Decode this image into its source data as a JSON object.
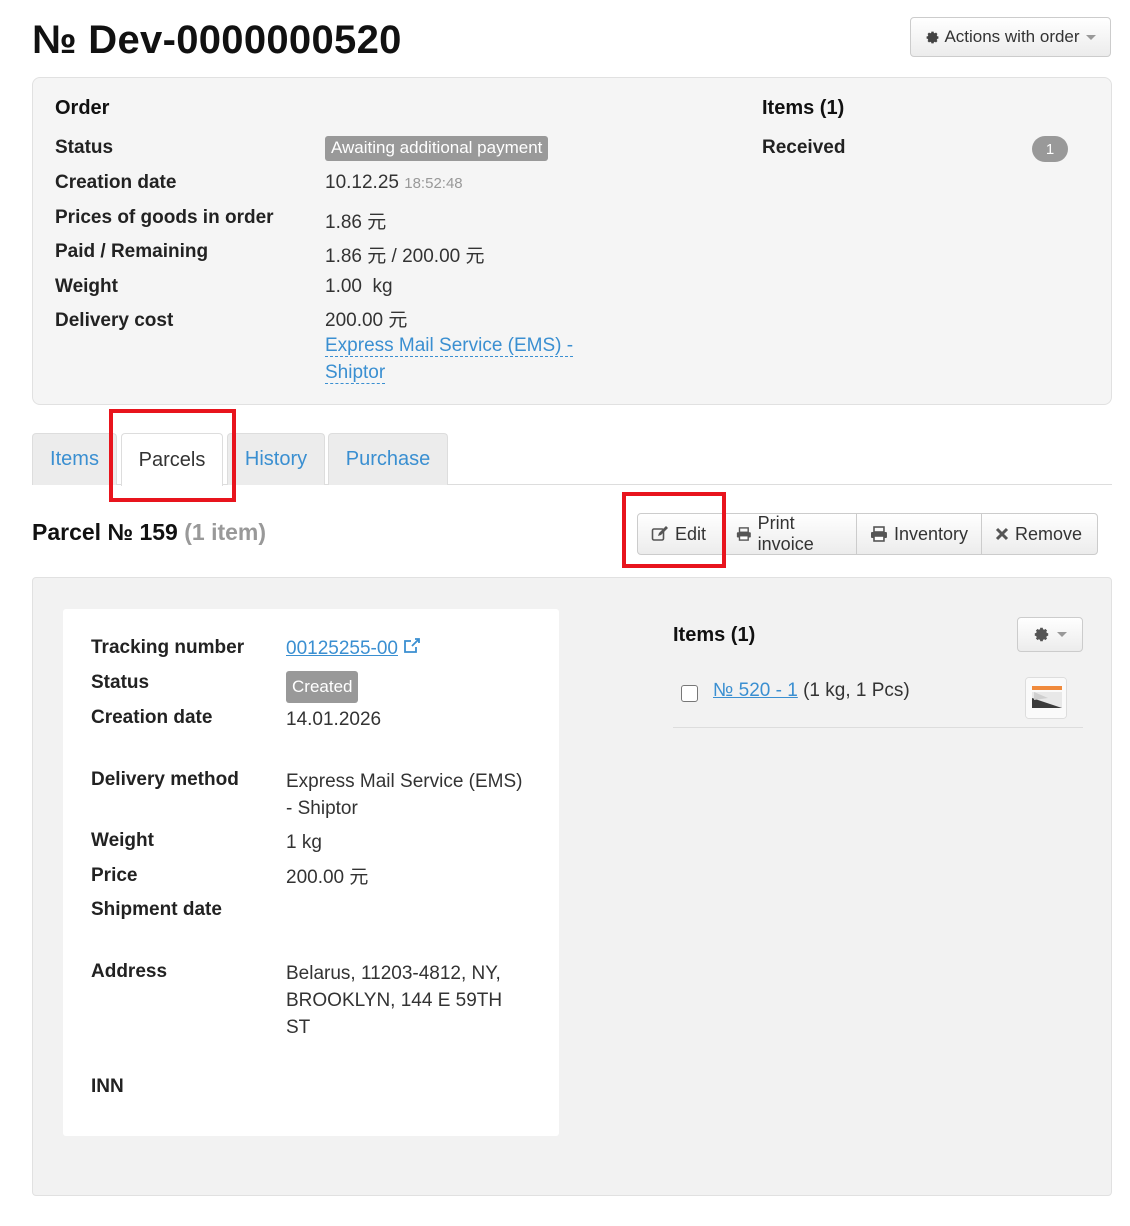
{
  "page": {
    "title": "№ Dev-0000000520"
  },
  "actions": {
    "label": "Actions with order"
  },
  "order": {
    "heading": "Order",
    "status_label": "Status",
    "status_value": "Awaiting additional payment",
    "creation_label": "Creation date",
    "creation_date": "10.12.25",
    "creation_time": "18:52:48",
    "prices_label": "Prices of goods in order",
    "prices_value": "1.86 元",
    "paid_label": "Paid / Remaining",
    "paid_value": "1.86 元 / 200.00 元",
    "weight_label": "Weight",
    "weight_value": "1.00  kg",
    "delivery_label": "Delivery cost",
    "delivery_value": "200.00 元",
    "delivery_method_line1": "Express Mail Service (EMS) -",
    "delivery_method_line2": "Shiptor"
  },
  "items_summary": {
    "heading": "Items (1)",
    "received_label": "Received",
    "received_count": "1"
  },
  "tabs": [
    {
      "label": "Items",
      "active": false
    },
    {
      "label": "Parcels",
      "active": true
    },
    {
      "label": "History",
      "active": false
    },
    {
      "label": "Purchase",
      "active": false
    }
  ],
  "parcel": {
    "title": "Parcel № 159",
    "count": "(1 item)",
    "buttons": {
      "edit": "Edit",
      "print": "Print invoice",
      "inventory": "Inventory",
      "remove": "Remove"
    },
    "info": {
      "tracking_label": "Tracking number",
      "tracking_value": "00125255-00",
      "status_label": "Status",
      "status_value": "Created",
      "creation_label": "Creation date",
      "creation_value": "14.01.2026",
      "method_label": "Delivery method",
      "method_line1": "Express Mail Service (EMS)",
      "method_line2": "- Shiptor",
      "weight_label": "Weight",
      "weight_value": "1 kg",
      "price_label": "Price",
      "price_value": "200.00 元",
      "shipment_label": "Shipment date",
      "address_label": "Address",
      "address_line1": "Belarus, 11203-4812, NY,",
      "address_line2": "BROOKLYN, 144 E 59TH",
      "address_line3": "ST",
      "inn_label": "INN"
    },
    "items_heading": "Items (1)",
    "item": {
      "link": "№ 520 - 1",
      "details": "(1 kg, 1 Pcs)"
    }
  },
  "colors": {
    "link": "#3a8fd1",
    "highlight": "#e8141d",
    "badge": "#999999"
  },
  "icons": [
    "gear-icon",
    "caret-down-icon",
    "edit-icon",
    "printer-icon",
    "close-icon",
    "external-link-icon"
  ]
}
